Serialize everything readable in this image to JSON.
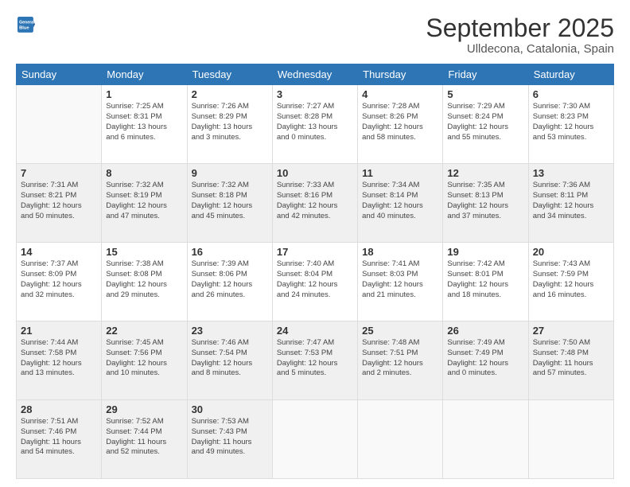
{
  "header": {
    "logo": {
      "line1": "General",
      "line2": "Blue"
    },
    "title": "September 2025",
    "subtitle": "Ulldecona, Catalonia, Spain"
  },
  "calendar": {
    "days_of_week": [
      "Sunday",
      "Monday",
      "Tuesday",
      "Wednesday",
      "Thursday",
      "Friday",
      "Saturday"
    ],
    "weeks": [
      [
        {
          "day": "",
          "info": ""
        },
        {
          "day": "1",
          "info": "Sunrise: 7:25 AM\nSunset: 8:31 PM\nDaylight: 13 hours\nand 6 minutes."
        },
        {
          "day": "2",
          "info": "Sunrise: 7:26 AM\nSunset: 8:29 PM\nDaylight: 13 hours\nand 3 minutes."
        },
        {
          "day": "3",
          "info": "Sunrise: 7:27 AM\nSunset: 8:28 PM\nDaylight: 13 hours\nand 0 minutes."
        },
        {
          "day": "4",
          "info": "Sunrise: 7:28 AM\nSunset: 8:26 PM\nDaylight: 12 hours\nand 58 minutes."
        },
        {
          "day": "5",
          "info": "Sunrise: 7:29 AM\nSunset: 8:24 PM\nDaylight: 12 hours\nand 55 minutes."
        },
        {
          "day": "6",
          "info": "Sunrise: 7:30 AM\nSunset: 8:23 PM\nDaylight: 12 hours\nand 53 minutes."
        }
      ],
      [
        {
          "day": "7",
          "info": "Sunrise: 7:31 AM\nSunset: 8:21 PM\nDaylight: 12 hours\nand 50 minutes."
        },
        {
          "day": "8",
          "info": "Sunrise: 7:32 AM\nSunset: 8:19 PM\nDaylight: 12 hours\nand 47 minutes."
        },
        {
          "day": "9",
          "info": "Sunrise: 7:32 AM\nSunset: 8:18 PM\nDaylight: 12 hours\nand 45 minutes."
        },
        {
          "day": "10",
          "info": "Sunrise: 7:33 AM\nSunset: 8:16 PM\nDaylight: 12 hours\nand 42 minutes."
        },
        {
          "day": "11",
          "info": "Sunrise: 7:34 AM\nSunset: 8:14 PM\nDaylight: 12 hours\nand 40 minutes."
        },
        {
          "day": "12",
          "info": "Sunrise: 7:35 AM\nSunset: 8:13 PM\nDaylight: 12 hours\nand 37 minutes."
        },
        {
          "day": "13",
          "info": "Sunrise: 7:36 AM\nSunset: 8:11 PM\nDaylight: 12 hours\nand 34 minutes."
        }
      ],
      [
        {
          "day": "14",
          "info": "Sunrise: 7:37 AM\nSunset: 8:09 PM\nDaylight: 12 hours\nand 32 minutes."
        },
        {
          "day": "15",
          "info": "Sunrise: 7:38 AM\nSunset: 8:08 PM\nDaylight: 12 hours\nand 29 minutes."
        },
        {
          "day": "16",
          "info": "Sunrise: 7:39 AM\nSunset: 8:06 PM\nDaylight: 12 hours\nand 26 minutes."
        },
        {
          "day": "17",
          "info": "Sunrise: 7:40 AM\nSunset: 8:04 PM\nDaylight: 12 hours\nand 24 minutes."
        },
        {
          "day": "18",
          "info": "Sunrise: 7:41 AM\nSunset: 8:03 PM\nDaylight: 12 hours\nand 21 minutes."
        },
        {
          "day": "19",
          "info": "Sunrise: 7:42 AM\nSunset: 8:01 PM\nDaylight: 12 hours\nand 18 minutes."
        },
        {
          "day": "20",
          "info": "Sunrise: 7:43 AM\nSunset: 7:59 PM\nDaylight: 12 hours\nand 16 minutes."
        }
      ],
      [
        {
          "day": "21",
          "info": "Sunrise: 7:44 AM\nSunset: 7:58 PM\nDaylight: 12 hours\nand 13 minutes."
        },
        {
          "day": "22",
          "info": "Sunrise: 7:45 AM\nSunset: 7:56 PM\nDaylight: 12 hours\nand 10 minutes."
        },
        {
          "day": "23",
          "info": "Sunrise: 7:46 AM\nSunset: 7:54 PM\nDaylight: 12 hours\nand 8 minutes."
        },
        {
          "day": "24",
          "info": "Sunrise: 7:47 AM\nSunset: 7:53 PM\nDaylight: 12 hours\nand 5 minutes."
        },
        {
          "day": "25",
          "info": "Sunrise: 7:48 AM\nSunset: 7:51 PM\nDaylight: 12 hours\nand 2 minutes."
        },
        {
          "day": "26",
          "info": "Sunrise: 7:49 AM\nSunset: 7:49 PM\nDaylight: 12 hours\nand 0 minutes."
        },
        {
          "day": "27",
          "info": "Sunrise: 7:50 AM\nSunset: 7:48 PM\nDaylight: 11 hours\nand 57 minutes."
        }
      ],
      [
        {
          "day": "28",
          "info": "Sunrise: 7:51 AM\nSunset: 7:46 PM\nDaylight: 11 hours\nand 54 minutes."
        },
        {
          "day": "29",
          "info": "Sunrise: 7:52 AM\nSunset: 7:44 PM\nDaylight: 11 hours\nand 52 minutes."
        },
        {
          "day": "30",
          "info": "Sunrise: 7:53 AM\nSunset: 7:43 PM\nDaylight: 11 hours\nand 49 minutes."
        },
        {
          "day": "",
          "info": ""
        },
        {
          "day": "",
          "info": ""
        },
        {
          "day": "",
          "info": ""
        },
        {
          "day": "",
          "info": ""
        }
      ]
    ]
  }
}
